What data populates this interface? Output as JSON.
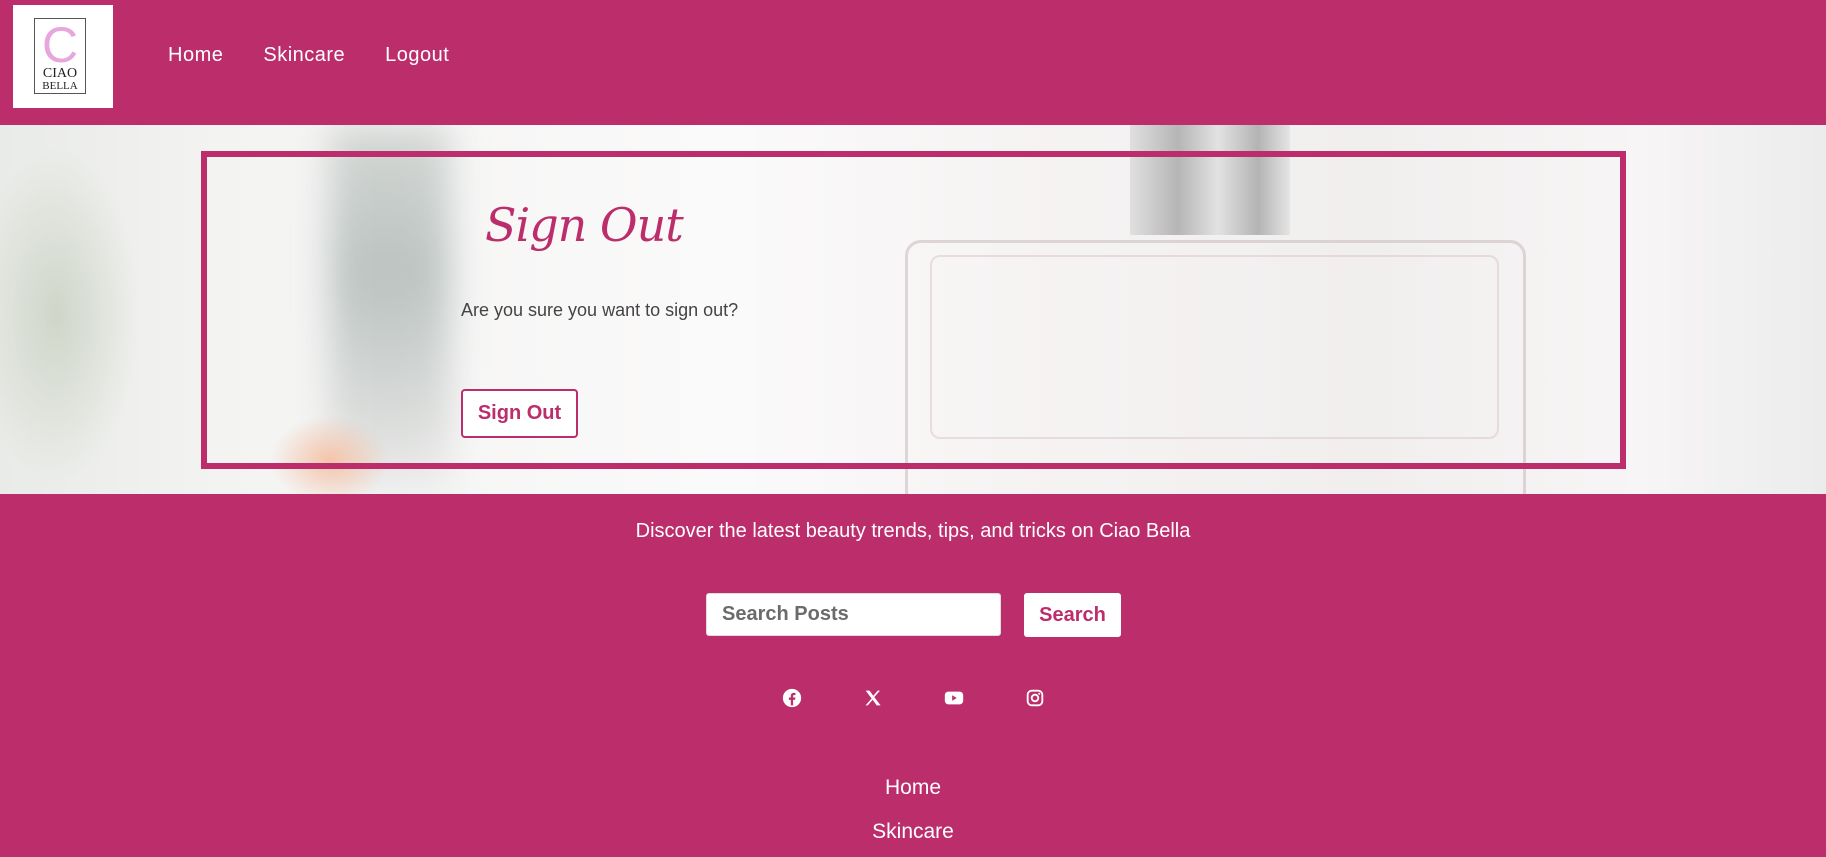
{
  "header": {
    "logo": {
      "line1": "CIAO",
      "line2": "BELLA",
      "letter": "C"
    },
    "nav": [
      {
        "label": "Home"
      },
      {
        "label": "Skincare"
      },
      {
        "label": "Logout"
      }
    ]
  },
  "main": {
    "title": "Sign Out",
    "message": "Are you sure you want to sign out?",
    "button_label": "Sign Out"
  },
  "footer": {
    "tagline": "Discover the latest beauty trends, tips, and tricks on Ciao Bella",
    "search": {
      "placeholder": "Search Posts",
      "button_label": "Search"
    },
    "social_icons": [
      "facebook-icon",
      "x-twitter-icon",
      "youtube-icon",
      "instagram-icon"
    ],
    "nav": [
      {
        "label": "Home"
      },
      {
        "label": "Skincare"
      }
    ]
  },
  "colors": {
    "brand": "#bc2d6b",
    "text": "#444444",
    "logo_accent": "#e7a6dc"
  }
}
